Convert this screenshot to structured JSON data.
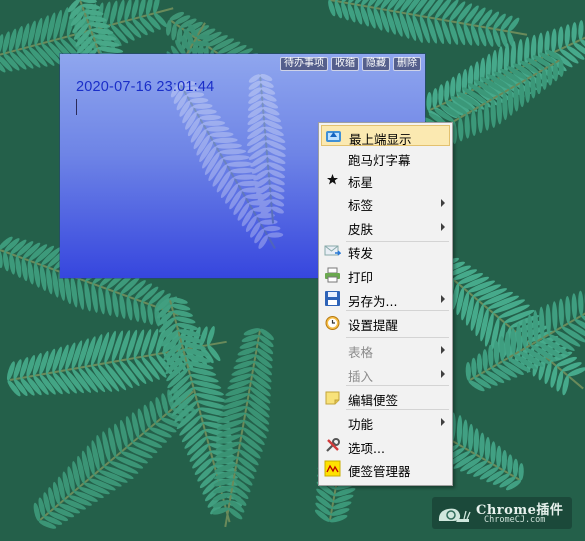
{
  "note": {
    "toolbar": [
      "待办事项",
      "收缩",
      "隐藏",
      "删除"
    ],
    "datetime": "2020-07-16 23:01:44"
  },
  "menu": {
    "items": [
      {
        "label": "最上端显示",
        "icon": "pin-top-icon",
        "submenu": false,
        "disabled": false,
        "highlighted": true
      },
      {
        "label": "跑马灯字幕",
        "icon": "",
        "submenu": false,
        "disabled": false
      },
      {
        "label": "标星",
        "icon": "star-icon",
        "submenu": false,
        "disabled": false
      },
      {
        "label": "标签",
        "icon": "",
        "submenu": true,
        "disabled": false
      },
      {
        "label": "皮肤",
        "icon": "",
        "submenu": true,
        "disabled": false
      },
      {
        "label": "转发",
        "icon": "forward-mail-icon",
        "submenu": false,
        "disabled": false
      },
      {
        "label": "打印",
        "icon": "printer-icon",
        "submenu": false,
        "disabled": false
      },
      {
        "label": "另存为...",
        "icon": "save-disk-icon",
        "submenu": true,
        "disabled": false
      },
      {
        "label": "设置提醒",
        "icon": "alarm-clock-icon",
        "submenu": false,
        "disabled": false
      },
      {
        "label": "表格",
        "icon": "",
        "submenu": true,
        "disabled": true
      },
      {
        "label": "插入",
        "icon": "",
        "submenu": true,
        "disabled": true
      },
      {
        "label": "编辑便签",
        "icon": "edit-note-icon",
        "submenu": false,
        "disabled": false
      },
      {
        "label": "功能",
        "icon": "",
        "submenu": true,
        "disabled": false
      },
      {
        "label": "选项...",
        "icon": "tools-icon",
        "submenu": false,
        "disabled": false
      },
      {
        "label": "便签管理器",
        "icon": "note-manager-icon",
        "submenu": false,
        "disabled": false
      }
    ]
  },
  "watermark": {
    "title": "Chrome插件",
    "url": "ChromeCJ.com"
  }
}
